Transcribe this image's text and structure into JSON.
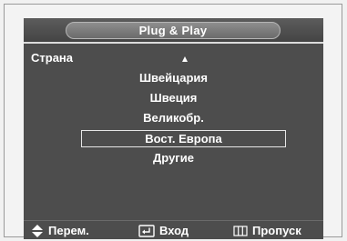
{
  "title": "Plug & Play",
  "field_label": "Страна",
  "options": [
    "Швейцария",
    "Швеция",
    "Великобр.",
    "Вост. Европа",
    "Другие"
  ],
  "selected_index": 3,
  "hints": [
    {
      "icon": "up-down-arrows-icon",
      "label": "Перем."
    },
    {
      "icon": "enter-icon",
      "label": "Вход"
    },
    {
      "icon": "menu-grid-icon",
      "label": "Пропуск"
    }
  ],
  "colors": {
    "panel": "#4d4d4d",
    "text": "#ffffff",
    "background": "#f1f1f1"
  }
}
